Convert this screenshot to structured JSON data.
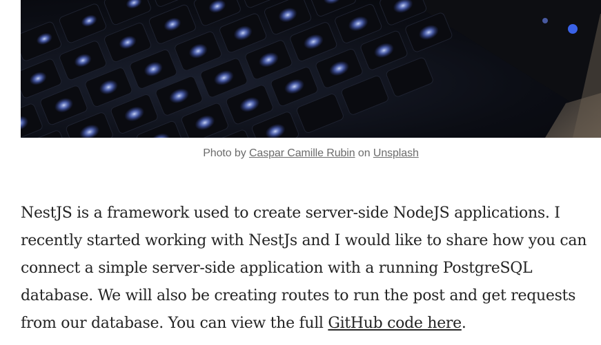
{
  "hero_image": {
    "description_icon": "keyboard-photo"
  },
  "caption": {
    "prefix": "Photo by ",
    "author_link": "Caspar Camille Rubin",
    "middle": " on ",
    "site_link": "Unsplash"
  },
  "article": {
    "intro_text": "NestJS is a framework used to create server-side NodeJS applications. I recently started working with NestJs and I would like to share how you can connect a simple server-side application with a running PostgreSQL database. We will also be creating routes to run the post and get requests from our database. You can view the full ",
    "github_link": "GitHub code here",
    "end_punctuation": "."
  },
  "colors": {
    "text": "#242424",
    "caption": "#6b6b6b",
    "key_glow": "#8fa8ff"
  }
}
